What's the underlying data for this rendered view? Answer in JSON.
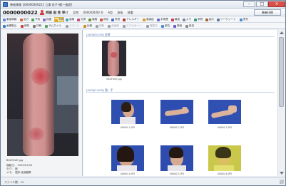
{
  "window": {
    "title": "患者情報【0000000022】江東 花子 様[一般歴]"
  },
  "patient": {
    "id": "0000000022",
    "name": "同田 田 佳 子",
    "info": [
      "56才",
      "女性",
      "0000/00/00 生",
      "A型",
      "身長",
      "体重"
    ],
    "print_button": "患者印刷"
  },
  "toolbar1": [
    {
      "label": "患者情報",
      "icon_color": "#5b8bd6"
    },
    {
      "label": "処方",
      "icon_color": "#d46a3a"
    },
    {
      "label": "予約",
      "icon_color": "#4aa55a"
    },
    {
      "label": "検査",
      "icon_color": "#8b6bc9"
    },
    {
      "label": "写真",
      "icon_color": "#e3a21a"
    },
    {
      "label": "画像",
      "icon_color": "#3fa3b8"
    },
    {
      "label": "文書",
      "icon_color": "#c94a7b"
    },
    {
      "label": "保険",
      "icon_color": "#6b8f3a"
    },
    {
      "label": "病名",
      "icon_color": "#d0513b"
    },
    {
      "label": "所見",
      "icon_color": "#4a72c9"
    },
    {
      "label": "アレルギー",
      "icon_color": "#b03a3a"
    },
    {
      "label": "感染症",
      "icon_color": "#d89a2a"
    },
    {
      "label": "手術歴",
      "icon_color": "#6a6ac9"
    },
    {
      "label": "輸血",
      "icon_color": "#c93a4a"
    },
    {
      "label": "メモ",
      "icon_color": "#7a8a9a"
    },
    {
      "label": "来院",
      "icon_color": "#3a9a7a"
    },
    {
      "label": "紹介",
      "icon_color": "#9a6a3a"
    },
    {
      "label": "ワークシート",
      "icon_color": "#5a7aa0"
    },
    {
      "label": "受付",
      "icon_color": "#4a8ad0"
    }
  ],
  "toolbar2": [
    {
      "label": "画像取込",
      "icon_color": "#3a7ad0",
      "dim": false
    },
    {
      "label": "削除",
      "icon_color": "#c94040",
      "dim": false
    },
    {
      "label": "印刷",
      "icon_color": "#7a7a7a",
      "dim": false
    },
    {
      "label": "サムネイル",
      "icon_color": "#5aa05a",
      "dim": false
    },
    {
      "label": "スライド",
      "icon_color": "#a0a0a0",
      "dim": true
    },
    {
      "label": "比較",
      "icon_color": "#d08a2a",
      "dim": false
    },
    {
      "label": "回転",
      "icon_color": "#a0a0a0",
      "dim": true
    },
    {
      "label": "全画面",
      "icon_color": "#a0a0a0",
      "dim": true
    },
    {
      "label": "エクスポート",
      "icon_color": "#a0a0a0",
      "dim": true
    },
    {
      "label": "撮影日",
      "icon_color": "#a0a0a0",
      "dim": true
    },
    {
      "label": "部位",
      "icon_color": "#4a8ad0",
      "dim": false
    },
    {
      "label": "検索",
      "icon_color": "#6a5ac9",
      "dim": false
    },
    {
      "label": "設定",
      "icon_color": "#8a8a8a",
      "dim": false
    }
  ],
  "left_meta": {
    "filename": "BSUFKUE.jpg",
    "date_label": "撮影日：",
    "date_value": "2009/01/30",
    "tag_label": "タグ：",
    "tag_value": "腕",
    "memo_label": "メモ：",
    "memo_value": "湿疹 経過観察"
  },
  "sections": [
    {
      "header": "[2009/01/30] 皮膚",
      "thumbs": [
        {
          "caption": "BSUFKUE.jpg"
        }
      ]
    },
    {
      "header": "[2008/12/05] 顔・手",
      "thumbs": [
        {
          "caption": "00000-1.JPG"
        },
        {
          "caption": "00000-2.JPG"
        },
        {
          "caption": "00000-3.JPG"
        },
        {
          "caption": "00000-4.JPG"
        },
        {
          "caption": "00000-5.JPG"
        },
        {
          "caption": "00000-6.JPG"
        }
      ]
    }
  ],
  "status": {
    "text": "ファイル数：10"
  },
  "colors": {
    "accent": "#4a6ea8",
    "active_tab": "#f8e6a6",
    "patient_icon": "#d23b3b"
  }
}
